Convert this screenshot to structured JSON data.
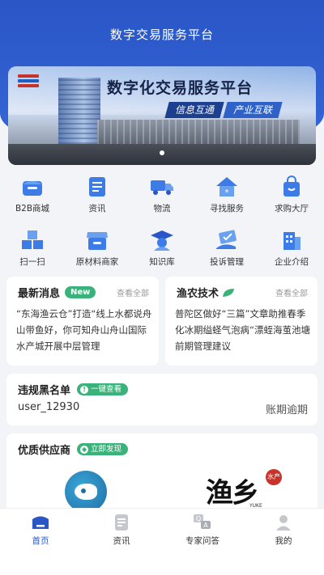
{
  "app": {
    "title": "数字交易服务平台"
  },
  "banner": {
    "heading": "数字化交易服务平台",
    "tags": [
      "信息互通",
      "产业互联"
    ]
  },
  "grid": [
    {
      "label": "B2B商城",
      "icon": "store-icon"
    },
    {
      "label": "资讯",
      "icon": "document-icon"
    },
    {
      "label": "物流",
      "icon": "truck-icon"
    },
    {
      "label": "寻找服务",
      "icon": "house-icon"
    },
    {
      "label": "求购大厅",
      "icon": "shopping-bag-icon"
    },
    {
      "label": "扫一扫",
      "icon": "cubes-icon"
    },
    {
      "label": "原材料商家",
      "icon": "shop-awning-icon"
    },
    {
      "label": "知识库",
      "icon": "graduate-icon"
    },
    {
      "label": "投诉管理",
      "icon": "hand-check-icon"
    },
    {
      "label": "企业介绍",
      "icon": "building-icon"
    }
  ],
  "news": {
    "title": "最新消息",
    "badge": "New",
    "see_all": "查看全部",
    "text": "“东海渔云仓”打造“线上水都说舟山带鱼好，你可知舟山舟山国际水产城开展中层管理"
  },
  "tech": {
    "title": "渔农技术",
    "see_all": "查看全部",
    "text": "普陀区做好“三篇”文章助推春季化冰期缢蛏气泡病“漂蛭海茧池塘前期管理建议"
  },
  "blacklist": {
    "title": "违规黑名单",
    "action": "一键查看",
    "user": "user_12930",
    "status": "账期逾期"
  },
  "supplier": {
    "title": "优质供应商",
    "action": "立即发现",
    "logo2_text": "渔乡",
    "logo2_seal": "水产",
    "logo2_en_1": "YUKE",
    "logo2_en_2": "seafoods"
  },
  "tabs": [
    {
      "label": "首页",
      "icon": "home-icon",
      "active": true
    },
    {
      "label": "资讯",
      "icon": "news-icon",
      "active": false
    },
    {
      "label": "专家问答",
      "icon": "qa-icon",
      "active": false
    },
    {
      "label": "我的",
      "icon": "user-icon",
      "active": false
    }
  ],
  "colors": {
    "primary": "#2a56c6",
    "accent_green": "#3ab37a",
    "icon_blue": "#3d7be6"
  }
}
